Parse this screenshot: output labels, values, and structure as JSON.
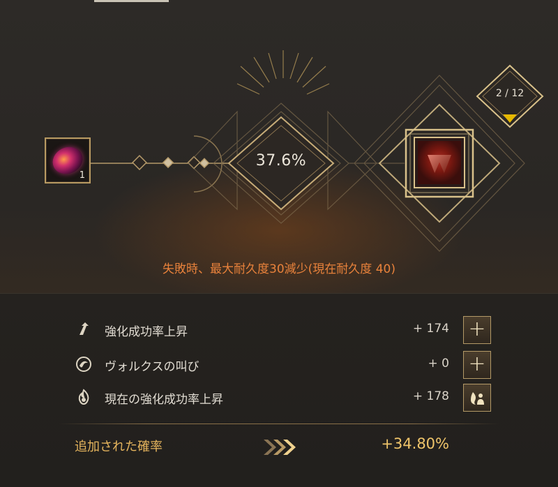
{
  "enhance": {
    "success_rate": "37.6%",
    "material_count": "1",
    "attempt_counter": "2 / 12",
    "failure_warning": "失敗時、最大耐久度30減少(現在耐久度 40)"
  },
  "stats": [
    {
      "label": "強化成功率上昇",
      "value": "+ 174",
      "icon": "arrow-up-icon",
      "button": "+"
    },
    {
      "label": "ヴォルクスの叫び",
      "value": "+ 0",
      "icon": "valks-cry-icon",
      "button": "+"
    },
    {
      "label": "現在の強化成功率上昇",
      "value": "+ 178",
      "icon": "flame-icon",
      "button": ""
    }
  ],
  "total": {
    "label": "追加された確率",
    "value": "+34.80%"
  },
  "colors": {
    "accent_gold": "#d9c18a",
    "warning_orange": "#e9823b",
    "total_gold": "#efc46a",
    "counter_marker": "#e6b800"
  }
}
